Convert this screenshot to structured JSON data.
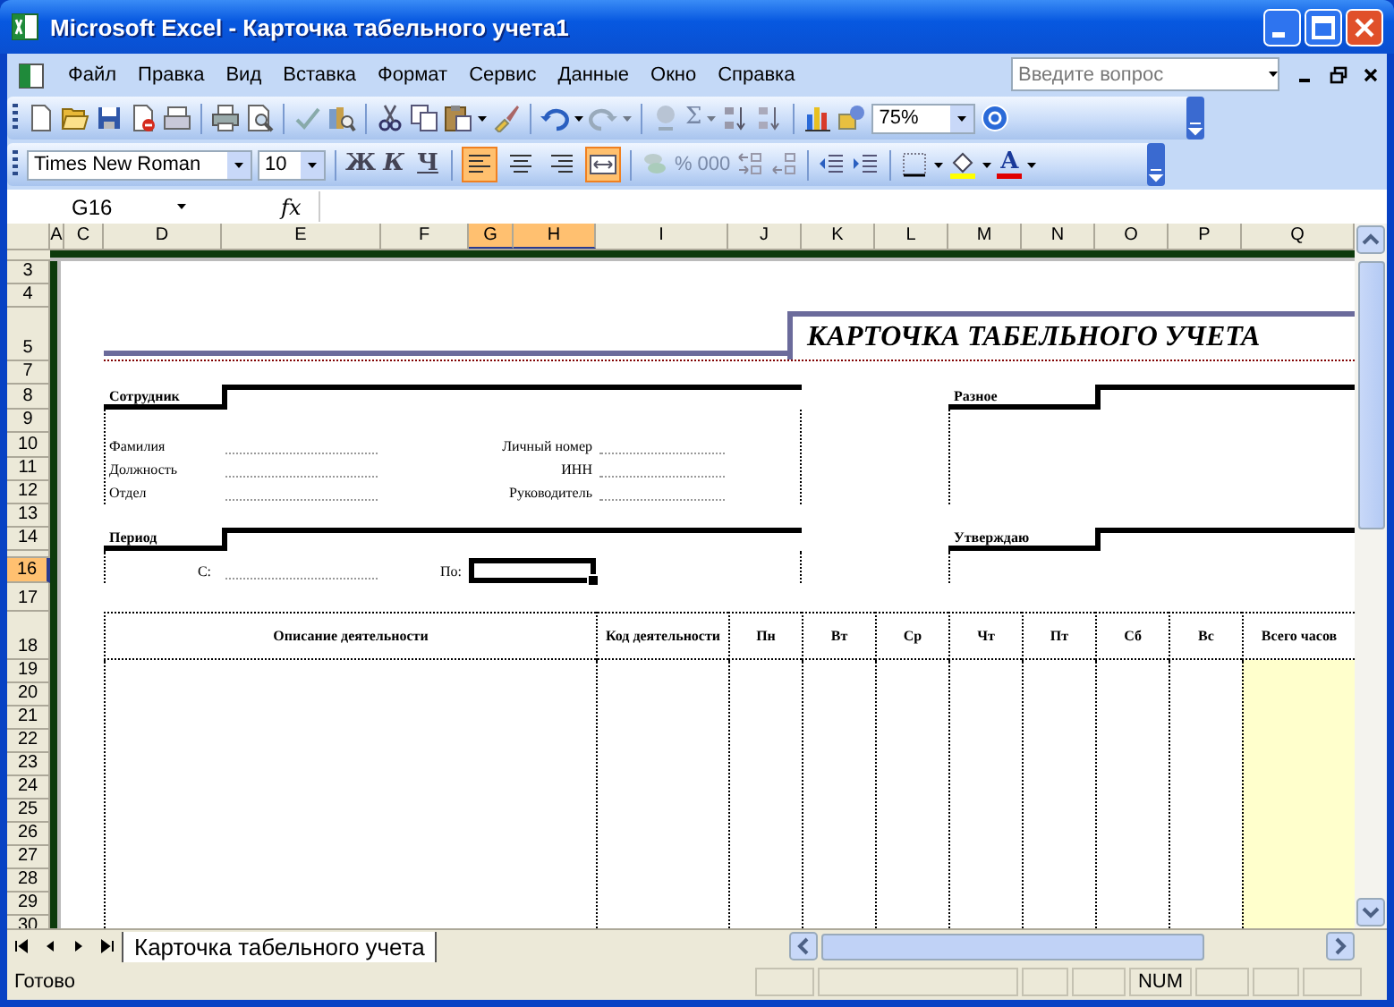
{
  "window": {
    "title": "Microsoft Excel - Карточка табельного учета1"
  },
  "menu": [
    "Файл",
    "Правка",
    "Вид",
    "Вставка",
    "Формат",
    "Сервис",
    "Данные",
    "Окно",
    "Справка"
  ],
  "help_search": {
    "placeholder": "Введите вопрос"
  },
  "standard_toolbar": {
    "autosum": "Σ",
    "zoom": "75%"
  },
  "formatting_toolbar": {
    "font": "Times New Roman",
    "size": "10",
    "styles": [
      "Ж",
      "К",
      "Ч"
    ],
    "alignment": [
      {
        "selected": true
      },
      {
        "selected": false
      },
      {
        "selected": false
      },
      {
        "selected": true
      }
    ],
    "number_formats": [
      "%",
      "000"
    ],
    "font_color_glyph": "A"
  },
  "formula_bar": {
    "name_box": "G16",
    "function_label": "fx"
  },
  "columns": [
    {
      "label": "A",
      "selected": false
    },
    {
      "label": "C",
      "selected": false
    },
    {
      "label": "D",
      "selected": false
    },
    {
      "label": "E",
      "selected": false
    },
    {
      "label": "F",
      "selected": false
    },
    {
      "label": "G",
      "selected": true
    },
    {
      "label": "H",
      "selected": true
    },
    {
      "label": "I",
      "selected": false
    },
    {
      "label": "J",
      "selected": false
    },
    {
      "label": "K",
      "selected": false
    },
    {
      "label": "L",
      "selected": false
    },
    {
      "label": "M",
      "selected": false
    },
    {
      "label": "N",
      "selected": false
    },
    {
      "label": "O",
      "selected": false
    },
    {
      "label": "P",
      "selected": false
    },
    {
      "label": "Q",
      "selected": false
    }
  ],
  "rows": [
    {
      "label": "3",
      "selected": false
    },
    {
      "label": "4",
      "selected": false
    },
    {
      "label": "5",
      "selected": false
    },
    {
      "label": "7",
      "selected": false
    },
    {
      "label": "8",
      "selected": false
    },
    {
      "label": "9",
      "selected": false
    },
    {
      "label": "10",
      "selected": false
    },
    {
      "label": "11",
      "selected": false
    },
    {
      "label": "12",
      "selected": false
    },
    {
      "label": "13",
      "selected": false
    },
    {
      "label": "14",
      "selected": false
    },
    {
      "selected": false
    },
    {
      "label": "16",
      "selected": true
    },
    {
      "label": "17",
      "selected": false
    },
    {
      "label": "18",
      "selected": false
    },
    {
      "label": "19",
      "selected": false
    },
    {
      "label": "20",
      "selected": false
    },
    {
      "label": "21",
      "selected": false
    },
    {
      "label": "22",
      "selected": false
    },
    {
      "label": "23",
      "selected": false
    },
    {
      "label": "24",
      "selected": false
    },
    {
      "label": "25",
      "selected": false
    },
    {
      "label": "26",
      "selected": false
    },
    {
      "label": "27",
      "selected": false
    },
    {
      "label": "28",
      "selected": false
    },
    {
      "label": "29",
      "selected": false
    },
    {
      "label": "30",
      "selected": false
    }
  ],
  "sheet": {
    "title": "КАРТОЧКА ТАБЕЛЬНОГО УЧЕТА",
    "employee": {
      "heading": "Сотрудник",
      "fields": [
        "Фамилия",
        "Должность",
        "Отдел"
      ],
      "fields_right": [
        "Личный номер",
        "ИНН",
        "Руководитель"
      ]
    },
    "misc": {
      "heading": "Разное"
    },
    "period": {
      "heading": "Период",
      "from": "С:",
      "to": "По:"
    },
    "approval": {
      "heading": "Утверждаю"
    },
    "table": {
      "columns": [
        "Описание деятельности",
        "Код деятельности",
        "Пн",
        "Вт",
        "Ср",
        "Чт",
        "Пт",
        "Сб",
        "Вс",
        "Всего часов"
      ]
    }
  },
  "sheet_tabs": [
    {
      "label": "Карточка табельного учета",
      "selected": true
    }
  ],
  "status_bar": {
    "text": "Готово",
    "indicators": [
      "NUM"
    ]
  }
}
